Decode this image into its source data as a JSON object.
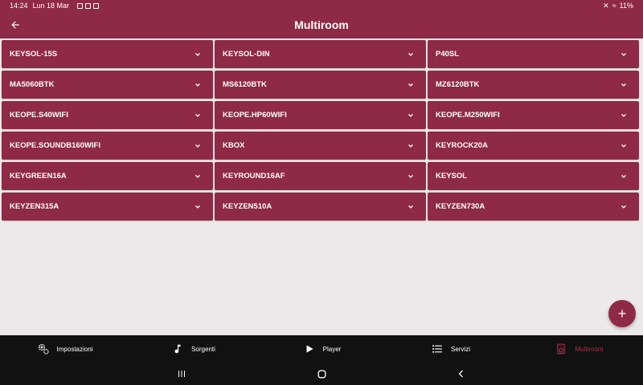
{
  "status": {
    "time": "14:24",
    "date": "Lun 18 Mar",
    "battery": "11%"
  },
  "app_bar": {
    "title": "Multiroom"
  },
  "devices": [
    {
      "label": "KEYSOL-15S"
    },
    {
      "label": "KEYSOL-DIN"
    },
    {
      "label": "P40SL"
    },
    {
      "label": "MA5060BTK"
    },
    {
      "label": "MS6120BTK"
    },
    {
      "label": "MZ6120BTK"
    },
    {
      "label": "KEOPE.S40WIFI"
    },
    {
      "label": "KEOPE.HP60WIFI"
    },
    {
      "label": "KEOPE.M250WIFI"
    },
    {
      "label": "KEOPE.SOUNDB160WIFI"
    },
    {
      "label": "KBOX"
    },
    {
      "label": "KEYROCK20A"
    },
    {
      "label": "KEYGREEN16A"
    },
    {
      "label": "KEYROUND16AF"
    },
    {
      "label": "KEYSOL"
    },
    {
      "label": "KEYZEN315A"
    },
    {
      "label": "KEYZEN510A"
    },
    {
      "label": "KEYZEN730A"
    }
  ],
  "fab": {
    "icon": "plus-icon",
    "symbol": "+"
  },
  "nav": [
    {
      "label": "Impostazioni",
      "icon": "gears-icon"
    },
    {
      "label": "Sorgenti",
      "icon": "music-note-icon"
    },
    {
      "label": "Player",
      "icon": "play-icon"
    },
    {
      "label": "Servizi",
      "icon": "list-icon"
    },
    {
      "label": "Multiroom",
      "icon": "speaker-icon"
    }
  ],
  "colors": {
    "primary": "#8e2a45",
    "active_nav": "#a8324f",
    "background": "#ece9ea",
    "nav_bg": "#111111"
  }
}
